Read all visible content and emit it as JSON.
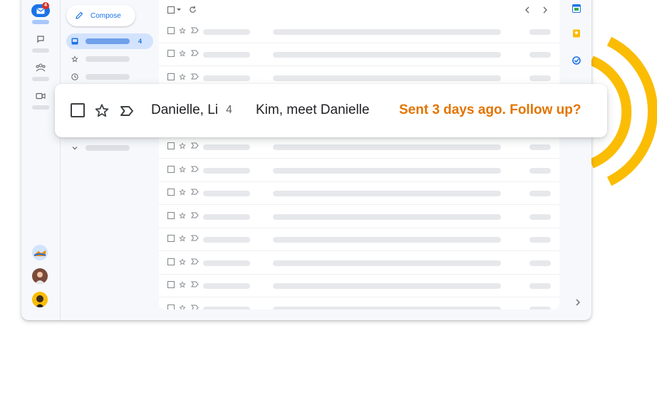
{
  "colors": {
    "accent": "#1a73e8",
    "nudge": "#e37400",
    "arc": "#fbbc04",
    "badge": "#d93025"
  },
  "rail": {
    "mail_badge": "4",
    "items": [
      "mail-icon",
      "chat-icon",
      "spaces-icon",
      "meet-icon"
    ]
  },
  "nav": {
    "compose_label": "Compose",
    "inbox_count": "4"
  },
  "card": {
    "sender": "Danielle, Li",
    "thread_count": "4",
    "subject": "Kim, meet Danielle",
    "nudge": "Sent 3 days ago. Follow up?"
  }
}
